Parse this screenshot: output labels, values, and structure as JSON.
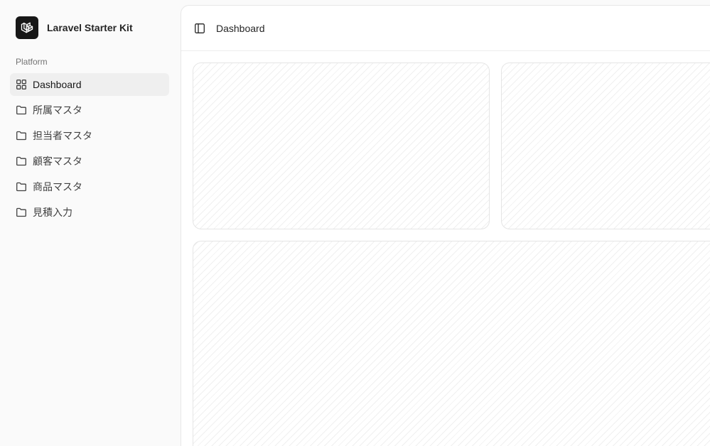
{
  "app": {
    "name": "Laravel Starter Kit"
  },
  "sidebar": {
    "group_label": "Platform",
    "items": [
      {
        "label": "Dashboard",
        "icon": "grid-icon",
        "active": true
      },
      {
        "label": "所属マスタ",
        "icon": "folder-icon"
      },
      {
        "label": "担当者マスタ",
        "icon": "folder-icon"
      },
      {
        "label": "顧客マスタ",
        "icon": "folder-icon"
      },
      {
        "label": "商品マスタ",
        "icon": "folder-icon"
      },
      {
        "label": "見積入力",
        "icon": "folder-icon"
      }
    ]
  },
  "header": {
    "toggle_icon": "panel-left-icon",
    "breadcrumb": "Dashboard"
  },
  "colors": {
    "logo_bg": "#171717",
    "active_item_bg": "#efefef",
    "sidebar_bg": "#fafafa",
    "main_bg": "#ffffff"
  }
}
